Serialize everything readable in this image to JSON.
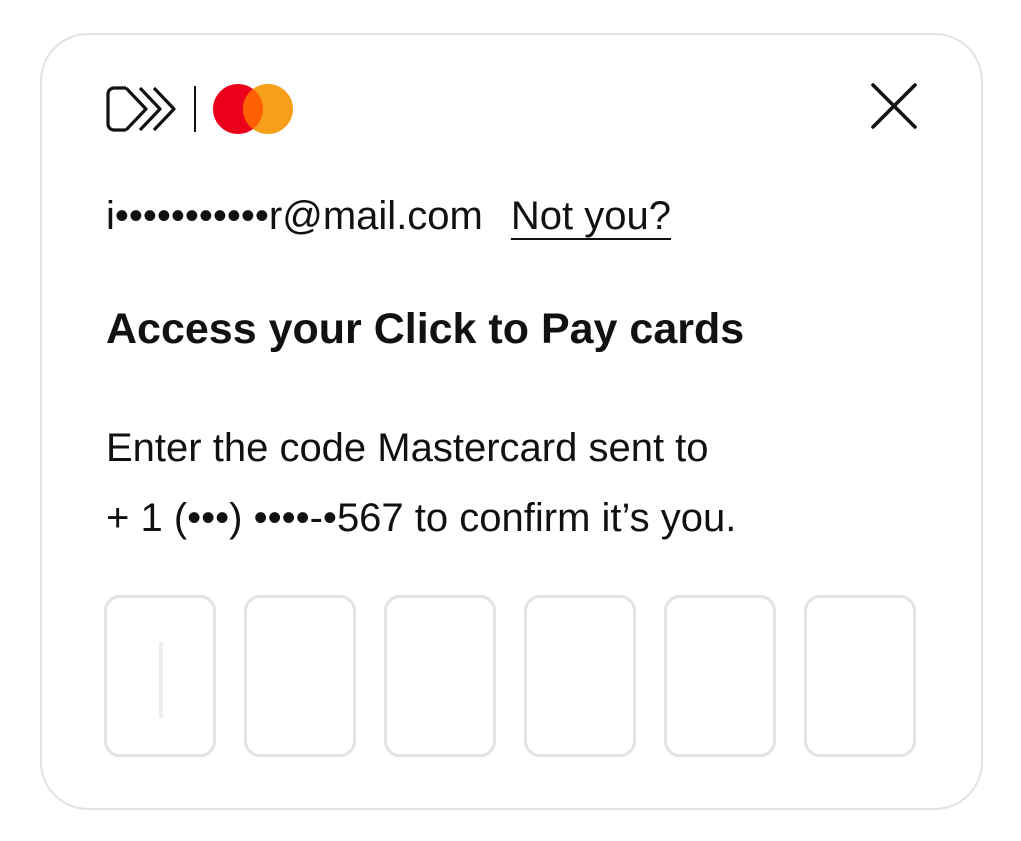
{
  "dialog": {
    "email_masked": "i•••••••••••r@mail.com",
    "not_you_label": "Not you?",
    "title": "Access your Click to Pay cards",
    "instructions_line1": "Enter the code Mastercard sent to",
    "instructions_line2": "+ 1 (•••) ••••-•567 to confirm it’s you."
  },
  "brand": {
    "click_to_pay_icon": "click-to-pay-icon",
    "mastercard_icon": "mastercard-logo",
    "mastercard_red": "#EB001B",
    "mastercard_orange": "#F79E1B",
    "mastercard_overlap": "#FF5F00"
  },
  "otp": {
    "length": 6,
    "digits": [
      "",
      "",
      "",
      "",
      "",
      ""
    ],
    "active_index": 0
  }
}
